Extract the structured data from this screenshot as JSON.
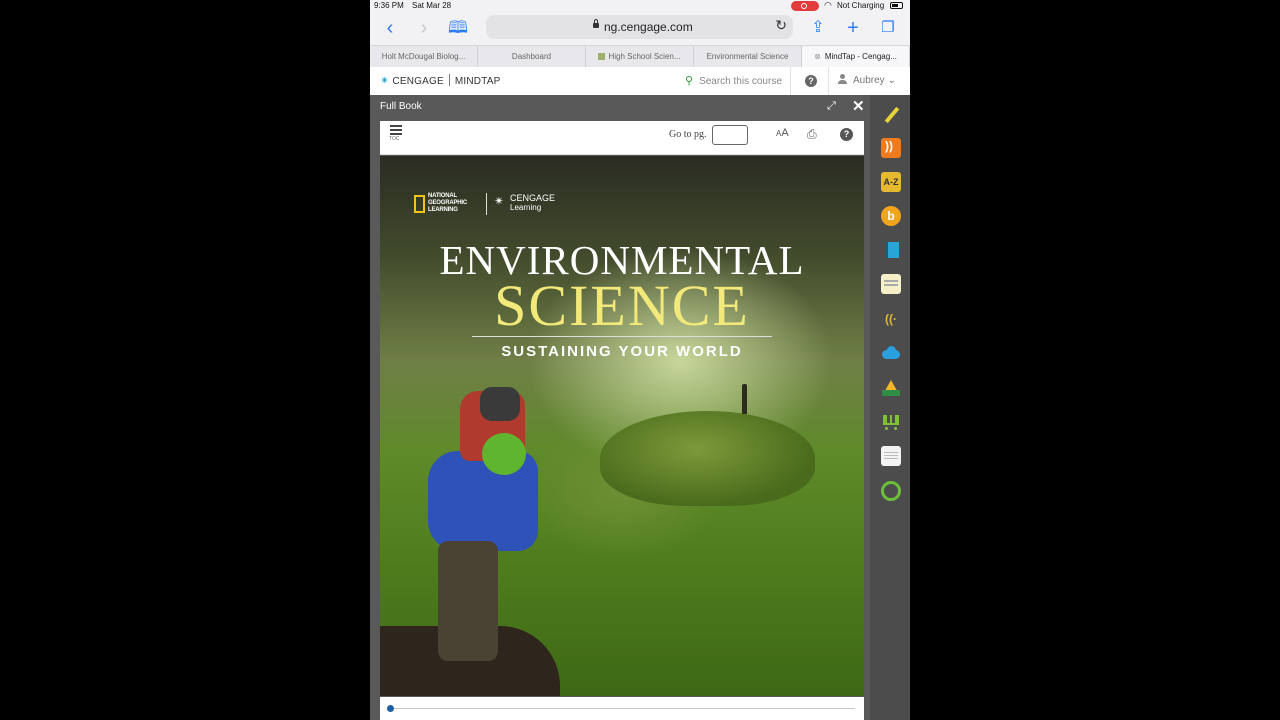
{
  "status_bar": {
    "time": "9:36 PM",
    "date": "Sat Mar 28",
    "charging": "Not Charging"
  },
  "browser": {
    "url": "ng.cengage.com",
    "tabs": [
      {
        "label": "Holt McDougal Biolog..."
      },
      {
        "label": "Dashboard"
      },
      {
        "label": "High School Scien..."
      },
      {
        "label": "Environmental Science"
      },
      {
        "label": "MindTap - Cengag..."
      }
    ],
    "active_tab": 4,
    "colors": {
      "accent": "#2f7cf6",
      "recording": "#e23b3b"
    }
  },
  "mindtap": {
    "brand": "CENGAGE",
    "product": "MINDTAP",
    "search_placeholder": "Search this course",
    "help_label": "?",
    "user_name": "Aubrey"
  },
  "reader": {
    "title": "Full Book",
    "toc_label": "TOC",
    "goto_label": "Go to pg.",
    "goto_value": "",
    "font_size_label": "AA",
    "help_label": "?"
  },
  "cover": {
    "publisher_ng": "NATIONAL GEOGRAPHIC LEARNING",
    "publisher_cengage": "CENGAGE",
    "publisher_cengage_sub": "Learning",
    "title_line1": "ENVIRONMENTAL",
    "title_line2": "SCIENCE",
    "subtitle": "SUSTAINING YOUR WORLD"
  },
  "pager": {
    "progress": 0.0
  },
  "dock": {
    "items": [
      {
        "icon": "highlighter-pencil-icon"
      },
      {
        "icon": "rss-feed-icon"
      },
      {
        "icon": "a-z-glossary-icon",
        "text": "A-Z"
      },
      {
        "icon": "bookshare-b-icon",
        "text": "b"
      },
      {
        "icon": "ebook-icon"
      },
      {
        "icon": "notes-icon"
      },
      {
        "icon": "read-speaker-icon",
        "text": "((·"
      },
      {
        "icon": "onedrive-cloud-icon"
      },
      {
        "icon": "google-drive-icon"
      },
      {
        "icon": "cart-icon"
      },
      {
        "icon": "document-icon"
      },
      {
        "icon": "progress-ring-icon"
      }
    ]
  }
}
